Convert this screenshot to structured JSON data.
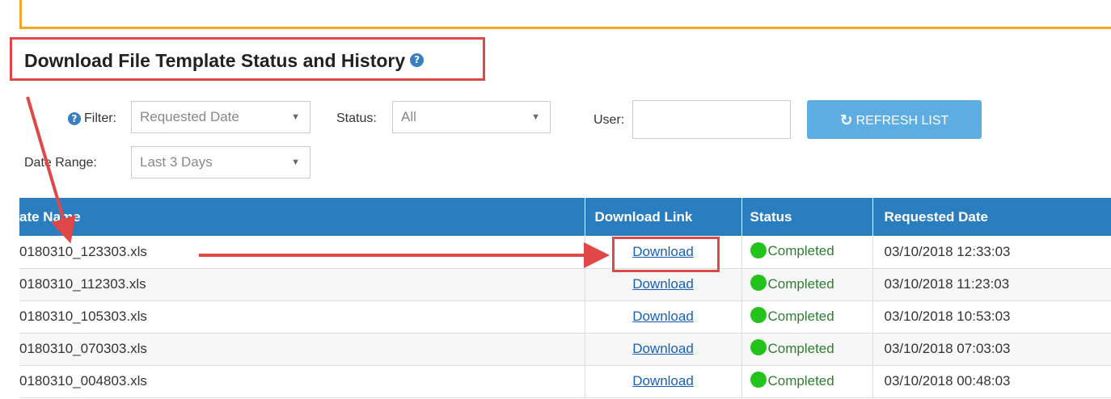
{
  "title": "Download File Template Status and History",
  "help_glyph": "?",
  "filters": {
    "filter_label": "Filter:",
    "filter_value": "Requested Date",
    "status_label": "Status:",
    "status_value": "All",
    "user_label": "User:",
    "user_value": "",
    "date_range_label": "Date Range:",
    "date_range_value": "Last 3 Days",
    "caret": "▼"
  },
  "refresh_button": {
    "icon": "refresh-icon",
    "glyph": "↻",
    "label": "REFRESH LIST"
  },
  "table": {
    "headers": [
      "ate Name",
      "Download Link",
      "Status",
      "Requested Date"
    ],
    "rows": [
      {
        "file": "0180310_123303.xls",
        "link": "Download",
        "status": "Completed",
        "date": "03/10/2018 12:33:03"
      },
      {
        "file": "0180310_112303.xls",
        "link": "Download",
        "status": "Completed",
        "date": "03/10/2018 11:23:03"
      },
      {
        "file": "0180310_105303.xls",
        "link": "Download",
        "status": "Completed",
        "date": "03/10/2018 10:53:03"
      },
      {
        "file": "0180310_070303.xls",
        "link": "Download",
        "status": "Completed",
        "date": "03/10/2018 07:03:03"
      },
      {
        "file": "0180310_004803.xls",
        "link": "Download",
        "status": "Completed",
        "date": "03/10/2018 00:48:03"
      }
    ]
  },
  "colors": {
    "header_bg": "#2a7ebf",
    "button_bg": "#5dade2",
    "status_green": "#22c31b",
    "annotation_red": "#e04848",
    "frame_orange": "#f5a623"
  }
}
